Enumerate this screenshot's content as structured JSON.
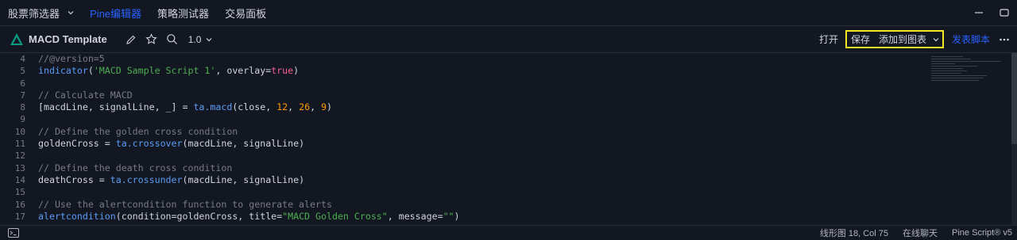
{
  "tabs": [
    {
      "label": "股票筛选器"
    },
    {
      "label": "Pine编辑器"
    },
    {
      "label": "策略测试器"
    },
    {
      "label": "交易面板"
    }
  ],
  "toolbar": {
    "title": "MACD Template",
    "version": "1.0",
    "open_label": "打开",
    "save_label": "保存",
    "add_to_chart_label": "添加到图表",
    "publish_label": "发表脚本"
  },
  "editor": {
    "line_numbers": [
      "4",
      "5",
      "6",
      "7",
      "8",
      "9",
      "10",
      "11",
      "12",
      "13",
      "14",
      "15",
      "16",
      "17"
    ],
    "lines": [
      [
        {
          "t": "//@version=5",
          "c": "com"
        }
      ],
      [
        {
          "t": "indicator",
          "c": "fn"
        },
        {
          "t": "(",
          "c": "plain"
        },
        {
          "t": "'MACD Sample Script 1'",
          "c": "str"
        },
        {
          "t": ", overlay=",
          "c": "plain"
        },
        {
          "t": "true",
          "c": "kw"
        },
        {
          "t": ")",
          "c": "plain"
        }
      ],
      [
        {
          "t": "",
          "c": "plain"
        }
      ],
      [
        {
          "t": "// Calculate MACD",
          "c": "com"
        }
      ],
      [
        {
          "t": "[macdLine, signalLine, _] = ",
          "c": "plain"
        },
        {
          "t": "ta.macd",
          "c": "fn"
        },
        {
          "t": "(close, ",
          "c": "plain"
        },
        {
          "t": "12",
          "c": "num"
        },
        {
          "t": ", ",
          "c": "plain"
        },
        {
          "t": "26",
          "c": "num"
        },
        {
          "t": ", ",
          "c": "plain"
        },
        {
          "t": "9",
          "c": "num"
        },
        {
          "t": ")",
          "c": "plain"
        }
      ],
      [
        {
          "t": "",
          "c": "plain"
        }
      ],
      [
        {
          "t": "// Define the golden cross condition",
          "c": "com"
        }
      ],
      [
        {
          "t": "goldenCross = ",
          "c": "plain"
        },
        {
          "t": "ta.crossover",
          "c": "fn"
        },
        {
          "t": "(macdLine, signalLine)",
          "c": "plain"
        }
      ],
      [
        {
          "t": "",
          "c": "plain"
        }
      ],
      [
        {
          "t": "// Define the death cross condition",
          "c": "com"
        }
      ],
      [
        {
          "t": "deathCross = ",
          "c": "plain"
        },
        {
          "t": "ta.crossunder",
          "c": "fn"
        },
        {
          "t": "(macdLine, signalLine)",
          "c": "plain"
        }
      ],
      [
        {
          "t": "",
          "c": "plain"
        }
      ],
      [
        {
          "t": "// Use the alertcondition function to generate alerts",
          "c": "com"
        }
      ],
      [
        {
          "t": "alertcondition",
          "c": "fn"
        },
        {
          "t": "(condition=goldenCross, title=",
          "c": "plain"
        },
        {
          "t": "\"MACD Golden Cross\"",
          "c": "str"
        },
        {
          "t": ", message=",
          "c": "plain"
        },
        {
          "t": "\"\"",
          "c": "str"
        },
        {
          "t": ")",
          "c": "plain"
        }
      ]
    ]
  },
  "status": {
    "position": "线形图 18, Col 75",
    "chat": "在线聊天",
    "language": "Pine Script® v5"
  },
  "colors": {
    "accent": "#2962ff",
    "highlight": "#f5e625",
    "background": "#131722"
  }
}
